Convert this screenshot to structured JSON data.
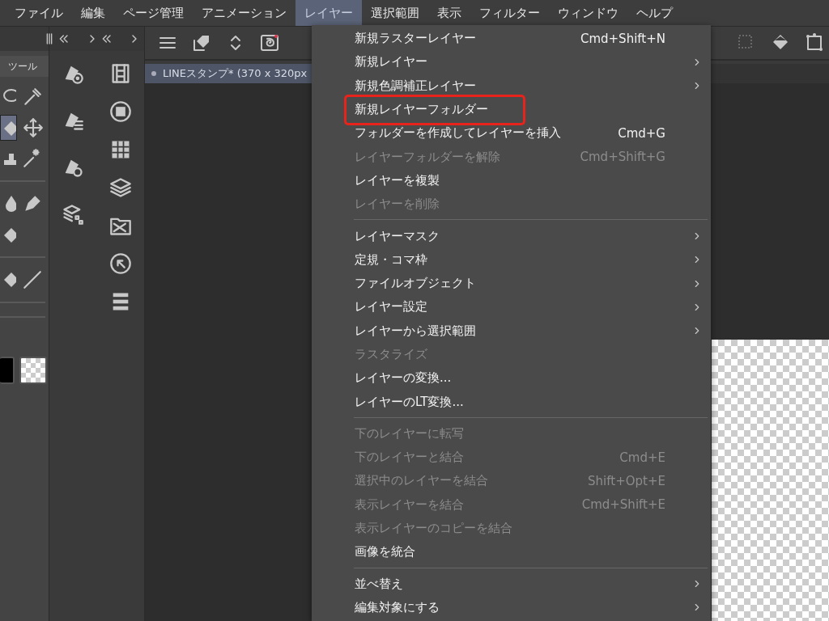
{
  "menubar": [
    {
      "label": "ファイル",
      "selected": false
    },
    {
      "label": "編集",
      "selected": false
    },
    {
      "label": "ページ管理",
      "selected": false
    },
    {
      "label": "アニメーション",
      "selected": false
    },
    {
      "label": "レイヤー",
      "selected": true
    },
    {
      "label": "選択範囲",
      "selected": false
    },
    {
      "label": "表示",
      "selected": false
    },
    {
      "label": "フィルター",
      "selected": false
    },
    {
      "label": "ウィンドウ",
      "selected": false
    },
    {
      "label": "ヘルプ",
      "selected": false
    }
  ],
  "tool_panel": {
    "tab": "ツール"
  },
  "document_tab": {
    "title": "LINEスタンプ* (370 x 320px"
  },
  "menu": {
    "items": [
      {
        "kind": "item",
        "label": "新規ラスターレイヤー",
        "shortcut": "Cmd+Shift+N",
        "submenu": false,
        "disabled": false,
        "highlighted": false
      },
      {
        "kind": "item",
        "label": "新規レイヤー",
        "submenu": true,
        "disabled": false,
        "highlighted": false
      },
      {
        "kind": "item",
        "label": "新規色調補正レイヤー",
        "submenu": true,
        "disabled": false,
        "highlighted": false
      },
      {
        "kind": "item",
        "label": "新規レイヤーフォルダー",
        "submenu": false,
        "disabled": false,
        "highlighted": true
      },
      {
        "kind": "item",
        "label": "フォルダーを作成してレイヤーを挿入",
        "shortcut": "Cmd+G",
        "submenu": false,
        "disabled": false,
        "highlighted": false
      },
      {
        "kind": "item",
        "label": "レイヤーフォルダーを解除",
        "shortcut": "Cmd+Shift+G",
        "submenu": false,
        "disabled": true,
        "highlighted": false
      },
      {
        "kind": "item",
        "label": "レイヤーを複製",
        "submenu": false,
        "disabled": false,
        "highlighted": false
      },
      {
        "kind": "item",
        "label": "レイヤーを削除",
        "submenu": false,
        "disabled": true,
        "highlighted": false
      },
      {
        "kind": "separator"
      },
      {
        "kind": "item",
        "label": "レイヤーマスク",
        "submenu": true,
        "disabled": false,
        "highlighted": false
      },
      {
        "kind": "item",
        "label": "定規・コマ枠",
        "submenu": true,
        "disabled": false,
        "highlighted": false
      },
      {
        "kind": "item",
        "label": "ファイルオブジェクト",
        "submenu": true,
        "disabled": false,
        "highlighted": false
      },
      {
        "kind": "item",
        "label": "レイヤー設定",
        "submenu": true,
        "disabled": false,
        "highlighted": false
      },
      {
        "kind": "item",
        "label": "レイヤーから選択範囲",
        "submenu": true,
        "disabled": false,
        "highlighted": false
      },
      {
        "kind": "item",
        "label": "ラスタライズ",
        "submenu": false,
        "disabled": true,
        "highlighted": false
      },
      {
        "kind": "item",
        "label": "レイヤーの変換...",
        "submenu": false,
        "disabled": false,
        "highlighted": false
      },
      {
        "kind": "item",
        "label": "レイヤーのLT変換...",
        "submenu": false,
        "disabled": false,
        "highlighted": false
      },
      {
        "kind": "separator"
      },
      {
        "kind": "item",
        "label": "下のレイヤーに転写",
        "submenu": false,
        "disabled": true,
        "highlighted": false
      },
      {
        "kind": "item",
        "label": "下のレイヤーと結合",
        "shortcut": "Cmd+E",
        "submenu": false,
        "disabled": true,
        "highlighted": false
      },
      {
        "kind": "item",
        "label": "選択中のレイヤーを結合",
        "shortcut": "Shift+Opt+E",
        "submenu": false,
        "disabled": true,
        "highlighted": false
      },
      {
        "kind": "item",
        "label": "表示レイヤーを結合",
        "shortcut": "Cmd+Shift+E",
        "submenu": false,
        "disabled": true,
        "highlighted": false
      },
      {
        "kind": "item",
        "label": "表示レイヤーのコピーを結合",
        "submenu": false,
        "disabled": true,
        "highlighted": false
      },
      {
        "kind": "item",
        "label": "画像を統合",
        "submenu": false,
        "disabled": false,
        "highlighted": false
      },
      {
        "kind": "separator"
      },
      {
        "kind": "item",
        "label": "並べ替え",
        "submenu": true,
        "disabled": false,
        "highlighted": false
      },
      {
        "kind": "item",
        "label": "編集対象にする",
        "submenu": true,
        "disabled": false,
        "highlighted": false
      }
    ]
  }
}
